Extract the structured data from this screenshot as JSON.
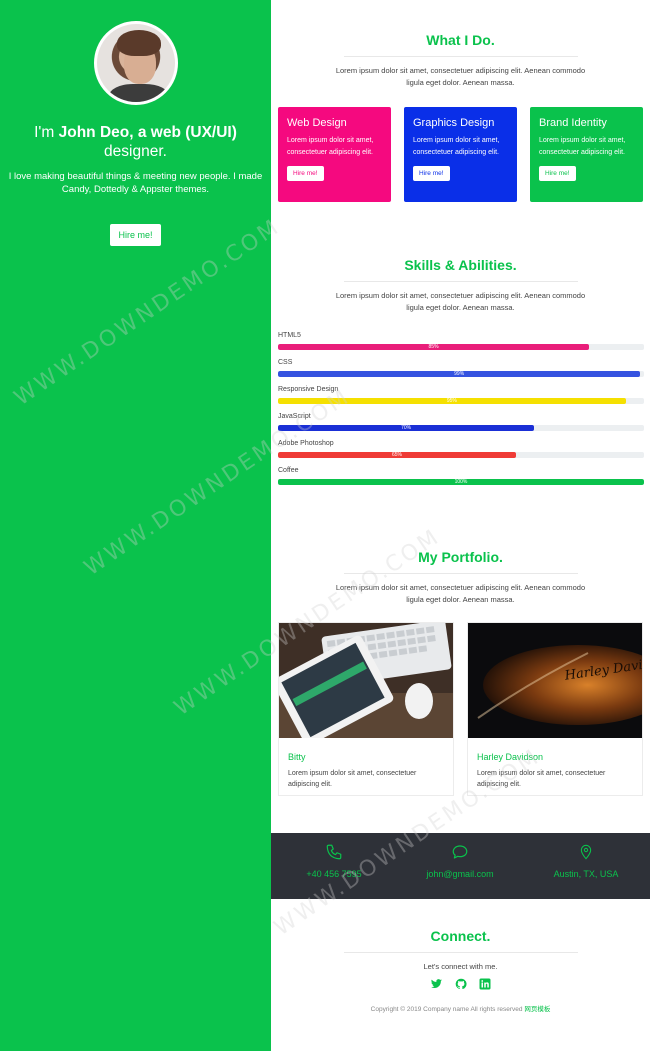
{
  "profile": {
    "intro_prefix": "I'm ",
    "name": "John Deo, a web (UX/UI)",
    "intro_suffix": "designer.",
    "tagline": "I love making beautiful things & meeting new people. I made Candy, Dottedly & Appster themes.",
    "hire_label": "Hire me!"
  },
  "what_i_do": {
    "title": "What I Do.",
    "description": "Lorem ipsum dolor sit amet, consectetuer adipiscing elit. Aenean commodo ligula eget dolor. Aenean massa.",
    "cards": [
      {
        "title": "Web Design",
        "text": "Lorem ipsum dolor sit amet, consectetuer adipiscing elit.",
        "button": "Hire me!",
        "color": "#f5097f"
      },
      {
        "title": "Graphics Design",
        "text": "Lorem ipsum dolor sit amet, consectetuer adipiscing elit.",
        "button": "Hire me!",
        "color": "#0a2fe8"
      },
      {
        "title": "Brand Identity",
        "text": "Lorem ipsum dolor sit amet, consectetuer adipiscing elit.",
        "button": "Hire me!",
        "color": "#0ac24c"
      }
    ]
  },
  "skills": {
    "title": "Skills & Abilities.",
    "description": "Lorem ipsum dolor sit amet, consectetuer adipiscing elit. Aenean commodo ligula eget dolor. Aenean massa.",
    "items": [
      {
        "name": "HTML5",
        "percent": 85,
        "label": "85%",
        "color": "#e91e7a"
      },
      {
        "name": "CSS",
        "percent": 99,
        "label": "99%",
        "color": "#3553e0"
      },
      {
        "name": "Responsive Design",
        "percent": 95,
        "label": "95%",
        "color": "#f5e000"
      },
      {
        "name": "JavaScript",
        "percent": 70,
        "label": "70%",
        "color": "#1a2fd6"
      },
      {
        "name": "Adobe Photoshop",
        "percent": 65,
        "label": "65%",
        "color": "#ef3b36"
      },
      {
        "name": "Coffee",
        "percent": 100,
        "label": "100%",
        "color": "#0ac24c"
      }
    ]
  },
  "portfolio": {
    "title": "My Portfolio.",
    "description": "Lorem ipsum dolor sit amet, consectetuer adipiscing elit. Aenean commodo ligula eget dolor. Aenean massa.",
    "items": [
      {
        "name": "Bitty",
        "text": "Lorem ipsum dolor sit amet, consectetuer adipiscing elit."
      },
      {
        "name": "Harley Davidson",
        "text": "Lorem ipsum dolor sit amet, consectetuer adipiscing elit.",
        "brand": "Harley Davidson"
      }
    ]
  },
  "contact": {
    "phone": "+40 456 7595",
    "email": "john@gmail.com",
    "location": "Austin, TX, USA"
  },
  "connect": {
    "title": "Connect.",
    "subtitle": "Let's connect with me.",
    "social_icons": [
      "twitter-icon",
      "github-icon",
      "linkedin-icon"
    ],
    "copyright": "Copyright © 2019 Company name All rights reserved",
    "copyright_link": "网页模板"
  },
  "watermark": "WWW.DOWNDEMO.COM"
}
